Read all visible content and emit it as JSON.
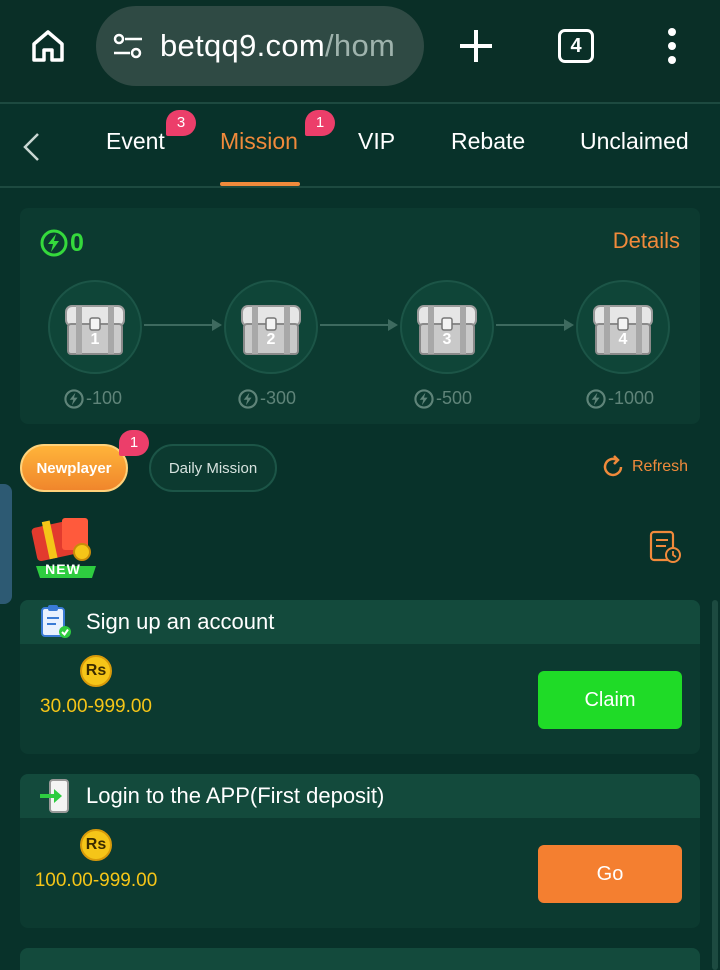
{
  "browser": {
    "url_host": "betqq9.com",
    "url_path": "/hom",
    "tab_count": "4"
  },
  "nav": {
    "tabs": [
      {
        "label": "Event",
        "badge": "3"
      },
      {
        "label": "Mission",
        "badge": "1",
        "active": true
      },
      {
        "label": "VIP"
      },
      {
        "label": "Rebate"
      },
      {
        "label": "Unclaimed"
      }
    ]
  },
  "chests": {
    "points": "0",
    "details_label": "Details",
    "items": [
      {
        "number": "1",
        "cost": "-100"
      },
      {
        "number": "2",
        "cost": "-300"
      },
      {
        "number": "3",
        "cost": "-500"
      },
      {
        "number": "4",
        "cost": "-1000"
      }
    ]
  },
  "filters": {
    "newplayer_label": "Newplayer",
    "newplayer_badge": "1",
    "daily_label": "Daily Mission",
    "refresh_label": "Refresh",
    "new_tag": "NEW"
  },
  "tasks": [
    {
      "title": "Sign up an account",
      "currency": "Rs",
      "reward": "30.00-999.00",
      "button": "Claim"
    },
    {
      "title": "Login to the APP(First deposit)",
      "currency": "Rs",
      "reward": "100.00-999.00",
      "button": "Go"
    }
  ],
  "colors": {
    "background": "#08322a",
    "accent_orange": "#f08a3b",
    "claim_green": "#1fdb27",
    "go_orange": "#f47f30",
    "coin_gold": "#f5c518",
    "badge_pink": "#ec3e6a"
  },
  "icons": [
    "home-icon",
    "tune-icon",
    "plus-icon",
    "more-vert-icon",
    "chevron-left-icon",
    "lightning-icon",
    "treasure-chest-icon",
    "refresh-icon",
    "gift-new-icon",
    "history-list-icon",
    "clipboard-check-icon",
    "phone-login-icon",
    "rupee-coin-icon"
  ]
}
